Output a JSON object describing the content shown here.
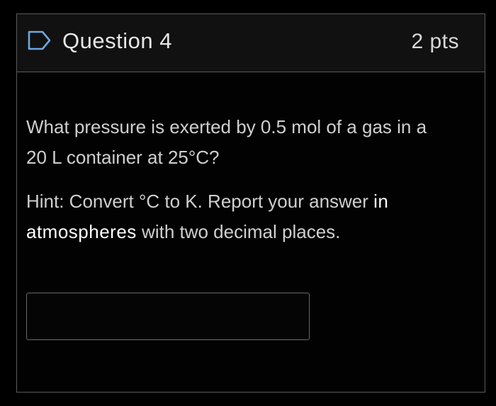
{
  "question": {
    "title": "Question 4",
    "points": "2 pts",
    "icon": "bookmark-flag-icon"
  },
  "prompt": {
    "text": "What pressure is exerted by 0.5 mol of a gas in a 20 L container at 25°C?",
    "hint_before": "Hint: Convert °C to K. Report your answer ",
    "hint_emphasis": "in atmospheres",
    "hint_after": " with two decimal places."
  },
  "answer": {
    "value": "",
    "placeholder": ""
  },
  "colors": {
    "background": "#000000",
    "header_bg": "#111111",
    "border": "#5a5a5a",
    "text": "#cfcfcf"
  }
}
